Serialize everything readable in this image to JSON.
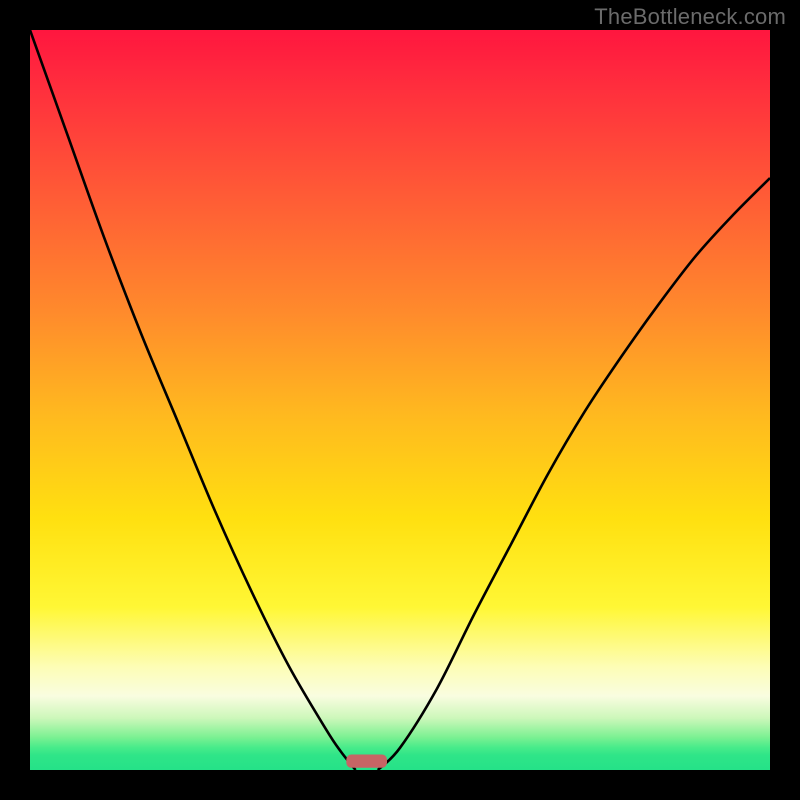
{
  "watermark": "TheBottleneck.com",
  "chart_data": {
    "type": "line",
    "title": "",
    "xlabel": "",
    "ylabel": "",
    "xlim": [
      0,
      1
    ],
    "ylim": [
      0,
      1
    ],
    "grid": false,
    "legend": false,
    "background_gradient": {
      "direction": "vertical_top_to_bottom",
      "stops": [
        {
          "pos": 0.0,
          "color": "#ff163f"
        },
        {
          "pos": 0.38,
          "color": "#ff8a2c"
        },
        {
          "pos": 0.66,
          "color": "#ffe010"
        },
        {
          "pos": 0.9,
          "color": "#f9fde0"
        },
        {
          "pos": 1.0,
          "color": "#25e288"
        }
      ]
    },
    "series": [
      {
        "name": "left-curve",
        "x": [
          0.0,
          0.05,
          0.1,
          0.15,
          0.2,
          0.25,
          0.3,
          0.35,
          0.4,
          0.42,
          0.44
        ],
        "y": [
          1.0,
          0.86,
          0.72,
          0.59,
          0.47,
          0.35,
          0.24,
          0.14,
          0.055,
          0.025,
          0.0
        ]
      },
      {
        "name": "right-curve",
        "x": [
          0.47,
          0.5,
          0.55,
          0.6,
          0.65,
          0.7,
          0.75,
          0.8,
          0.85,
          0.9,
          0.95,
          1.0
        ],
        "y": [
          0.0,
          0.03,
          0.11,
          0.21,
          0.305,
          0.4,
          0.485,
          0.56,
          0.63,
          0.695,
          0.75,
          0.8
        ]
      }
    ],
    "marker": {
      "shape": "rounded-rect",
      "x_center": 0.455,
      "y_center": 0.012,
      "width": 0.055,
      "height": 0.018,
      "color": "#c66565"
    }
  }
}
